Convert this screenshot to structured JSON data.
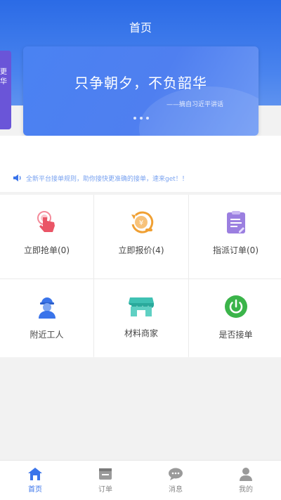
{
  "header": {
    "title": "首页"
  },
  "side_card": {
    "text": "更 华"
  },
  "banner": {
    "headline": "只争朝夕，不负韶华",
    "subline": "——摘自习近平讲话"
  },
  "notice": {
    "text": "全新平台接单规则，助你接快更准确的接单，速来get！！"
  },
  "grid": {
    "items": [
      {
        "label": "立即抢单(0)",
        "icon": "hand-tap-icon"
      },
      {
        "label": "立即报价(4)",
        "icon": "quote-coin-icon"
      },
      {
        "label": "指派订单(0)",
        "icon": "clipboard-icon"
      },
      {
        "label": "附近工人",
        "icon": "worker-icon"
      },
      {
        "label": "材料商家",
        "icon": "store-icon"
      },
      {
        "label": "是否接单",
        "icon": "power-toggle-icon"
      }
    ]
  },
  "tabbar": {
    "items": [
      {
        "label": "首页",
        "active": true
      },
      {
        "label": "订单",
        "active": false
      },
      {
        "label": "消息",
        "active": false
      },
      {
        "label": "我的",
        "active": false
      }
    ]
  },
  "colors": {
    "primary": "#3a74ea",
    "accent_orange": "#f0a033",
    "accent_green": "#3bb44a",
    "accent_purple": "#9b7fe0",
    "accent_red": "#ea5566"
  }
}
